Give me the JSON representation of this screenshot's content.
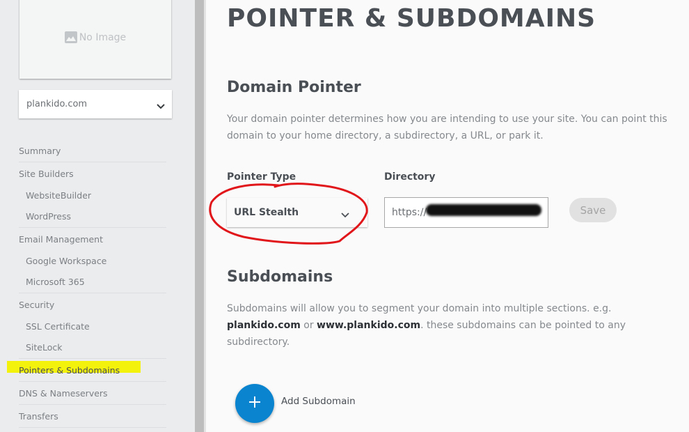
{
  "sidebar": {
    "image_placeholder": {
      "label": "No Image",
      "icon": "image-icon"
    },
    "domain_select": {
      "value": "plankido.com",
      "icon": "chevron-down-icon"
    },
    "nav": {
      "summary": "Summary",
      "site_builders": {
        "label": "Site Builders",
        "items": [
          "WebsiteBuilder",
          "WordPress"
        ]
      },
      "email_management": {
        "label": "Email Management",
        "items": [
          "Google Workspace",
          "Microsoft 365"
        ]
      },
      "security": {
        "label": "Security",
        "items": [
          "SSL Certificate",
          "SiteLock"
        ]
      },
      "pointers_subdomains": "Pointers & Subdomains",
      "dns_nameservers": "DNS & Nameservers",
      "transfers": "Transfers"
    },
    "active_item": "Pointers & Subdomains",
    "highlight_color": "#f2f20c"
  },
  "main": {
    "title": "POINTER & SUBDOMAINS",
    "domain_pointer": {
      "heading": "Domain Pointer",
      "description": "Your domain pointer determines how you are intending to use your site. You can point this domain to your home directory, a subdirectory, a URL, or park it.",
      "pointer_type_label": "Pointer Type",
      "pointer_type_value": "URL Stealth",
      "directory_label": "Directory",
      "directory_value": "https://",
      "save_label": "Save"
    },
    "subdomains": {
      "heading": "Subdomains",
      "description_pre": "Subdomains will allow you to segment your domain into multiple sections. e.g. ",
      "example1": "plankido.com",
      "description_mid": " or ",
      "example2": "www.plankido.com",
      "description_post": ". these subdomains can be pointed to any subdirectory.",
      "add_label": "Add Subdomain",
      "add_icon": "plus-icon"
    }
  },
  "colors": {
    "accent": "#0a84cf",
    "annotation": "#e0161b",
    "text_dark": "#4a4f55"
  }
}
